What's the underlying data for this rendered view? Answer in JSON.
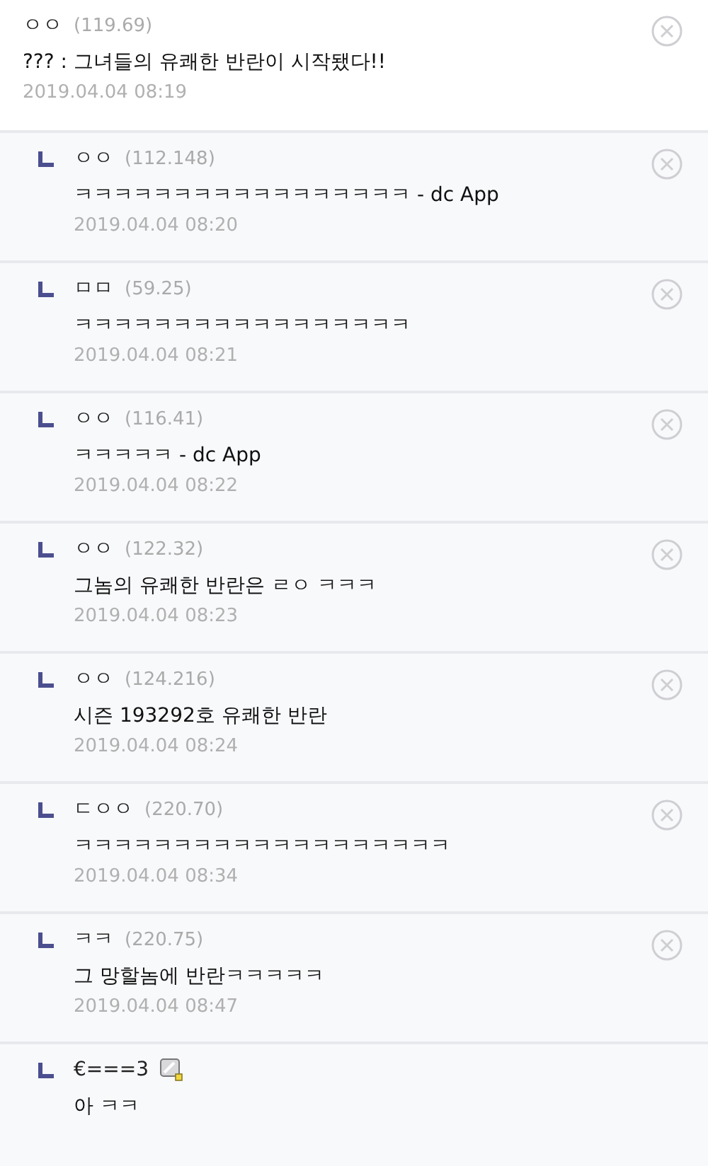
{
  "comments": [
    {
      "kind": "comment",
      "nickname": "ㅇㅇ",
      "ip": "(119.69)",
      "text": "??? : 그녀들의 유쾌한 반란이 시작됐다!!",
      "date": "2019.04.04 08:19",
      "deletable": true,
      "member_badge": false
    },
    {
      "kind": "reply",
      "nickname": "ㅇㅇ",
      "ip": "(112.148)",
      "text": "ㅋㅋㅋㅋㅋㅋㅋㅋㅋㅋㅋㅋㅋㅋㅋㅋㅋ - dc App",
      "date": "2019.04.04 08:20",
      "deletable": true,
      "member_badge": false
    },
    {
      "kind": "reply",
      "nickname": "ㅁㅁ",
      "ip": "(59.25)",
      "text": "ㅋㅋㅋㅋㅋㅋㅋㅋㅋㅋㅋㅋㅋㅋㅋㅋㅋ",
      "date": "2019.04.04 08:21",
      "deletable": true,
      "member_badge": false
    },
    {
      "kind": "reply",
      "nickname": "ㅇㅇ",
      "ip": "(116.41)",
      "text": "ㅋㅋㅋㅋㅋ - dc App",
      "date": "2019.04.04 08:22",
      "deletable": true,
      "member_badge": false
    },
    {
      "kind": "reply",
      "nickname": "ㅇㅇ",
      "ip": "(122.32)",
      "text": "그놈의 유쾌한 반란은 ㄹㅇ ㅋㅋㅋ",
      "date": "2019.04.04 08:23",
      "deletable": true,
      "member_badge": false
    },
    {
      "kind": "reply",
      "nickname": "ㅇㅇ",
      "ip": "(124.216)",
      "text": "시즌 193292호 유쾌한 반란",
      "date": "2019.04.04 08:24",
      "deletable": true,
      "member_badge": false
    },
    {
      "kind": "reply",
      "nickname": "ㄷㅇㅇ",
      "ip": "(220.70)",
      "text": "ㅋㅋㅋㅋㅋㅋㅋㅋㅋㅋㅋㅋㅋㅋㅋㅋㅋㅋㅋ",
      "date": "2019.04.04 08:34",
      "deletable": true,
      "member_badge": false
    },
    {
      "kind": "reply",
      "nickname": "ㅋㅋ",
      "ip": "(220.75)",
      "text": "그 망할놈에 반란ㅋㅋㅋㅋㅋ",
      "date": "2019.04.04 08:47",
      "deletable": true,
      "member_badge": false
    },
    {
      "kind": "reply",
      "nickname": "€===3",
      "text": "아 ㅋㅋ",
      "deletable": false,
      "member_badge": true
    }
  ]
}
